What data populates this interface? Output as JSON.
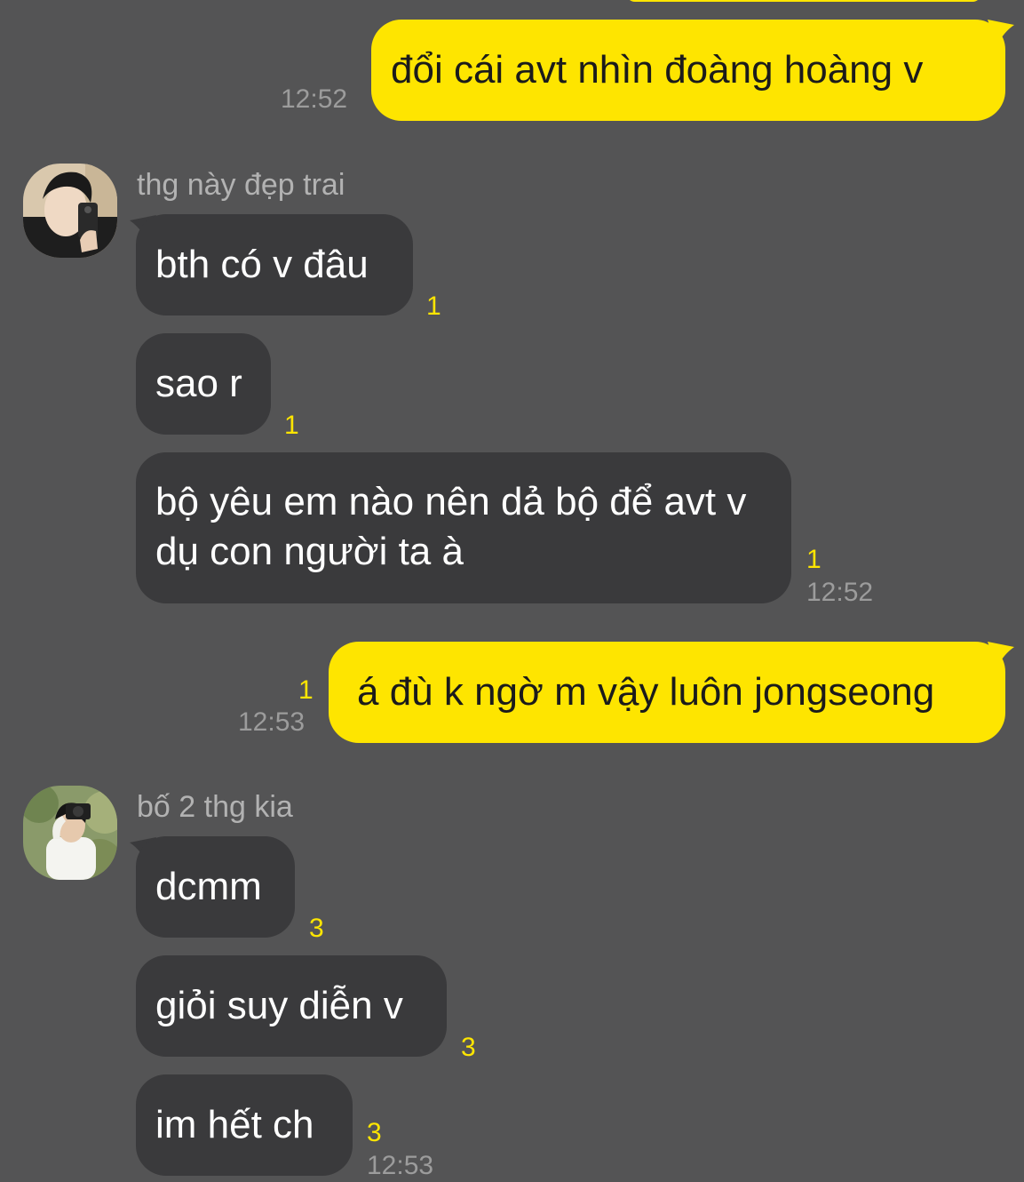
{
  "messages": {
    "m1": {
      "text": "đổi cái avt nhìn đoàng hoàng v",
      "time": "12:52"
    },
    "sender1": {
      "name": "thg này đẹp trai"
    },
    "m2": {
      "text": "bth có v đâu",
      "read": "1"
    },
    "m3": {
      "text": "sao r",
      "read": "1"
    },
    "m4": {
      "text": "bộ yêu em nào nên dả bộ để avt v dụ con người ta à",
      "read": "1",
      "time": "12:52"
    },
    "m5": {
      "text": "á đù k ngờ m vậy luôn jongseong",
      "read": "1",
      "time": "12:53"
    },
    "sender2": {
      "name": "bố 2 thg kia"
    },
    "m6": {
      "text": "dcmm",
      "read": "3"
    },
    "m7": {
      "text": "giỏi suy diễn v",
      "read": "3"
    },
    "m8": {
      "text": "im hết ch",
      "read": "3",
      "time": "12:53"
    }
  },
  "colors": {
    "background": "#545455",
    "my_bubble": "#FEE500",
    "their_bubble": "#3a3a3c",
    "read_count": "#FEE500",
    "timestamp": "#9c9c9c"
  },
  "icons": {
    "avatar1": "profile-photo-mirror-selfie",
    "avatar2": "profile-photo-camera-outdoor"
  }
}
